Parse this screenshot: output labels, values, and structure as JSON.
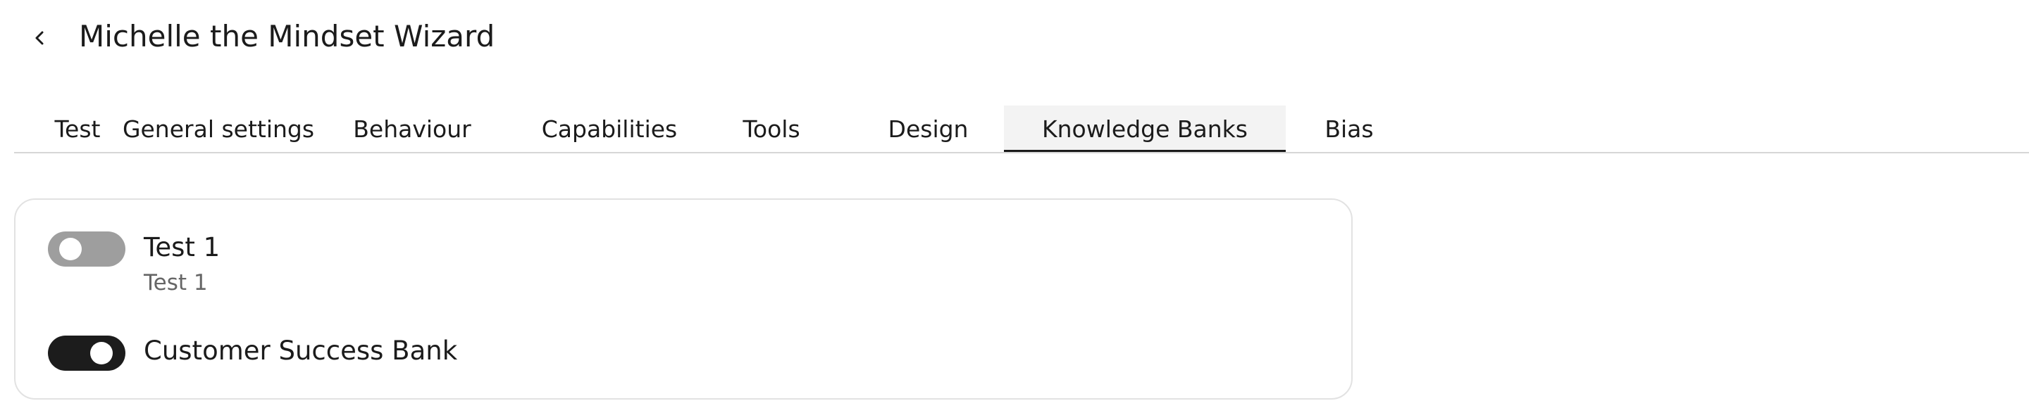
{
  "header": {
    "title": "Michelle the Mindset Wizard",
    "back_icon": "chevron-left-icon"
  },
  "tabs": [
    {
      "label": "Test",
      "active": false
    },
    {
      "label": "General settings",
      "active": false
    },
    {
      "label": "Behaviour",
      "active": false
    },
    {
      "label": "Capabilities",
      "active": false
    },
    {
      "label": "Tools",
      "active": false
    },
    {
      "label": "Design",
      "active": false
    },
    {
      "label": "Knowledge Banks",
      "active": true
    },
    {
      "label": "Bias",
      "active": false
    }
  ],
  "knowledge_banks": [
    {
      "name": "Test 1",
      "description": "Test 1",
      "enabled": false
    },
    {
      "name": "Customer Success Bank",
      "description": "",
      "enabled": true
    }
  ],
  "colors": {
    "toggle_on": "#1c1c1c",
    "toggle_off": "#9e9e9e",
    "active_tab_bg": "#f3f3f3",
    "active_tab_underline": "#1a1a1a"
  }
}
